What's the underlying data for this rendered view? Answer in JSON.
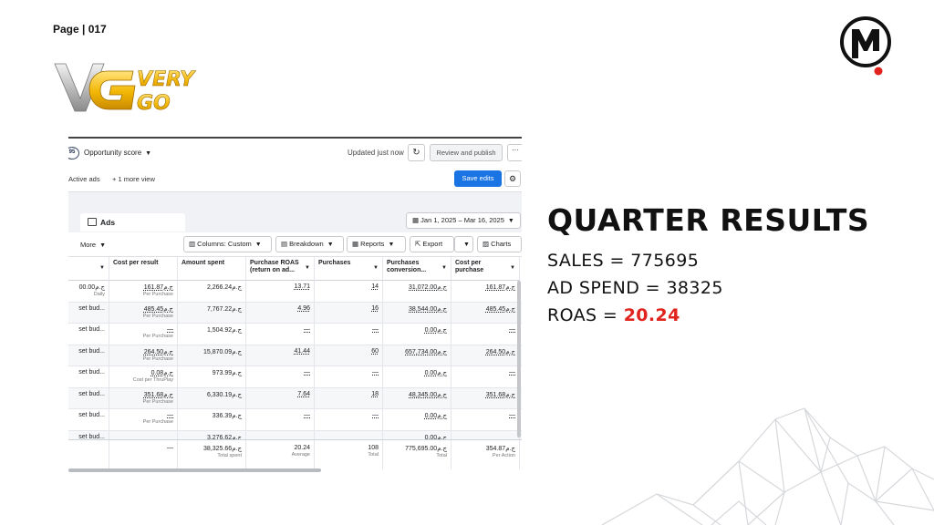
{
  "page_label": "Page | 017",
  "brand": {
    "vg_text": "VG",
    "very": "VERY",
    "go": "GO",
    "m_text": "M"
  },
  "results": {
    "title": "QUARTER RESULTS",
    "sales_label": "SALES = ",
    "sales_value": "775695",
    "spend_label": "AD SPEND = ",
    "spend_value": "38325",
    "roas_label": "ROAS = ",
    "roas_value": "20.24",
    "roas_color": "#e0231c"
  },
  "ads_manager": {
    "opportunity_badge": "95",
    "opportunity_label": "Opportunity score",
    "updated": "Updated just now",
    "review_button": "Review and publish",
    "more_button": "···",
    "active_ads": "Active ads",
    "more_view": "+  1 more view",
    "save_button": "Save edits",
    "ads_tab": "Ads",
    "date_range": "Jan 1, 2025 – Mar 16, 2025",
    "more_menu": "More",
    "columns_button": "Columns: Custom",
    "breakdown_button": "Breakdown",
    "reports_button": "Reports",
    "export_button": "Export",
    "charts_button": "Charts",
    "accent_color": "#1b74e4",
    "headers": [
      "Cost per result",
      "Amount spent",
      "Purchase ROAS (return on ad...",
      "Purchases",
      "Purchases conversion...",
      "Cost per purchase"
    ],
    "rows": [
      {
        "budget": "00.00ج.م",
        "budget_sub": "Daily",
        "cpr": "161.87ج.م",
        "cpr_sub": "Per Purchase",
        "spent": "2,266.24ج.م",
        "roas": "13.71",
        "purchases": "14",
        "conv": "31,072.00ج.م",
        "cpp": "161.87ج.م"
      },
      {
        "budget": "set bud...",
        "budget_sub": "",
        "cpr": "485.45ج.م",
        "cpr_sub": "Per Purchase",
        "spent": "7,767.22ج.م",
        "roas": "4.96",
        "purchases": "16",
        "conv": "38,544.00ج.م",
        "cpp": "485.45ج.م"
      },
      {
        "budget": "set bud...",
        "budget_sub": "",
        "cpr": "—",
        "cpr_sub": "Per Purchase",
        "spent": "1,504.92ج.م",
        "roas": "—",
        "purchases": "—",
        "conv": "0.00ج.م",
        "cpp": "—"
      },
      {
        "budget": "set bud...",
        "budget_sub": "",
        "cpr": "264.50ج.م",
        "cpr_sub": "Per Purchase",
        "spent": "15,870.09ج.م",
        "roas": "41.44",
        "purchases": "60",
        "conv": "657,734.00ج.م",
        "cpp": "264.50ج.م"
      },
      {
        "budget": "set bud...",
        "budget_sub": "",
        "cpr": "0.08ج.م",
        "cpr_sub": "Cost per ThruPlay",
        "spent": "973.99ج.م",
        "roas": "—",
        "purchases": "—",
        "conv": "0.00ج.م",
        "cpp": "—"
      },
      {
        "budget": "set bud...",
        "budget_sub": "",
        "cpr": "351.68ج.م",
        "cpr_sub": "Per Purchase",
        "spent": "6,330.19ج.م",
        "roas": "7.64",
        "purchases": "18",
        "conv": "48,345.00ج.م",
        "cpp": "351.68ج.م"
      },
      {
        "budget": "set bud...",
        "budget_sub": "",
        "cpr": "—",
        "cpr_sub": "Per Purchase",
        "spent": "336.39ج.م",
        "roas": "—",
        "purchases": "—",
        "conv": "0.00ج.م",
        "cpp": "—"
      },
      {
        "budget": "set bud...",
        "budget_sub": "",
        "cpr": "",
        "cpr_sub": "",
        "spent": "3,276.62ج.م",
        "roas": "",
        "purchases": "",
        "conv": "0.00ج.م",
        "cpp": ""
      }
    ],
    "totals": {
      "cpr": "—",
      "spent": "38,325.66ج.م",
      "spent_sub": "Total spent",
      "roas": "20.24",
      "roas_sub": "Average",
      "purchases": "108",
      "purchases_sub": "Total",
      "conv": "775,695.00ج.م",
      "conv_sub": "Total",
      "cpp": "354.87ج.م",
      "cpp_sub": "Per Action"
    }
  }
}
